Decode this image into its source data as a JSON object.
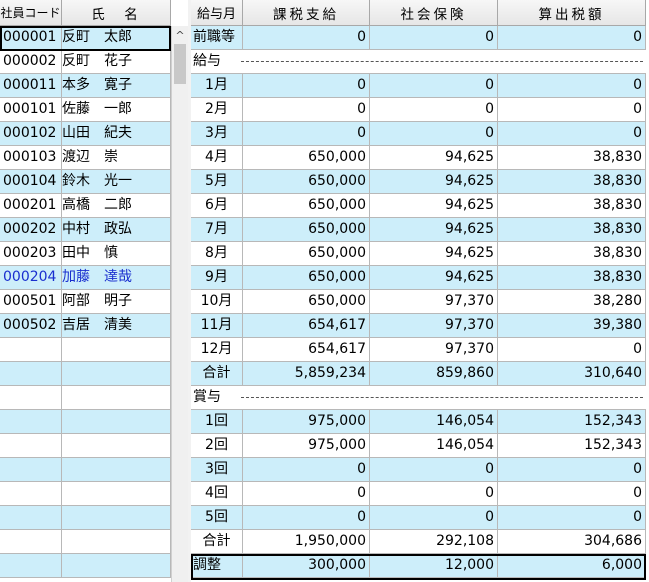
{
  "left_header": {
    "code": "社員コード",
    "name": "氏　名"
  },
  "employees": [
    {
      "code": "000001",
      "name": "反町　太郎"
    },
    {
      "code": "000002",
      "name": "反町　花子"
    },
    {
      "code": "000011",
      "name": "本多　寛子"
    },
    {
      "code": "000101",
      "name": "佐藤　一郎"
    },
    {
      "code": "000102",
      "name": "山田　紀夫"
    },
    {
      "code": "000103",
      "name": "渡辺　崇"
    },
    {
      "code": "000104",
      "name": "鈴木　光一"
    },
    {
      "code": "000201",
      "name": "高橋　二郎"
    },
    {
      "code": "000202",
      "name": "中村　政弘"
    },
    {
      "code": "000203",
      "name": "田中　慎"
    },
    {
      "code": "000204",
      "name": "加藤　達哉"
    },
    {
      "code": "000501",
      "name": "阿部　明子"
    },
    {
      "code": "000502",
      "name": "吉居　清美"
    }
  ],
  "right_header": {
    "period": "給与月",
    "taxable": "課税支給",
    "social": "社会保険",
    "tax": "算出税額"
  },
  "rows": [
    {
      "label": "前職等",
      "taxable": "0",
      "social": "0",
      "tax": "0"
    },
    {
      "label": "給与",
      "section": true
    },
    {
      "label": "1月",
      "taxable": "0",
      "social": "0",
      "tax": "0"
    },
    {
      "label": "2月",
      "taxable": "0",
      "social": "0",
      "tax": "0"
    },
    {
      "label": "3月",
      "taxable": "0",
      "social": "0",
      "tax": "0"
    },
    {
      "label": "4月",
      "taxable": "650,000",
      "social": "94,625",
      "tax": "38,830"
    },
    {
      "label": "5月",
      "taxable": "650,000",
      "social": "94,625",
      "tax": "38,830"
    },
    {
      "label": "6月",
      "taxable": "650,000",
      "social": "94,625",
      "tax": "38,830"
    },
    {
      "label": "7月",
      "taxable": "650,000",
      "social": "94,625",
      "tax": "38,830"
    },
    {
      "label": "8月",
      "taxable": "650,000",
      "social": "94,625",
      "tax": "38,830"
    },
    {
      "label": "9月",
      "taxable": "650,000",
      "social": "94,625",
      "tax": "38,830"
    },
    {
      "label": "10月",
      "taxable": "650,000",
      "social": "97,370",
      "tax": "38,280"
    },
    {
      "label": "11月",
      "taxable": "654,617",
      "social": "97,370",
      "tax": "39,380"
    },
    {
      "label": "12月",
      "taxable": "654,617",
      "social": "97,370",
      "tax": "0"
    },
    {
      "label": "合計",
      "taxable": "5,859,234",
      "social": "859,860",
      "tax": "310,640"
    },
    {
      "label": "賞与",
      "section": true
    },
    {
      "label": "1回",
      "taxable": "975,000",
      "social": "146,054",
      "tax": "152,343"
    },
    {
      "label": "2回",
      "taxable": "975,000",
      "social": "146,054",
      "tax": "152,343"
    },
    {
      "label": "3回",
      "taxable": "0",
      "social": "0",
      "tax": "0"
    },
    {
      "label": "4回",
      "taxable": "0",
      "social": "0",
      "tax": "0"
    },
    {
      "label": "5回",
      "taxable": "0",
      "social": "0",
      "tax": "0"
    },
    {
      "label": "合計",
      "taxable": "1,950,000",
      "social": "292,108",
      "tax": "304,686"
    },
    {
      "label": "調整",
      "taxable": "300,000",
      "social": "12,000",
      "tax": "6,000"
    }
  ],
  "scroll_up_glyph": "^"
}
